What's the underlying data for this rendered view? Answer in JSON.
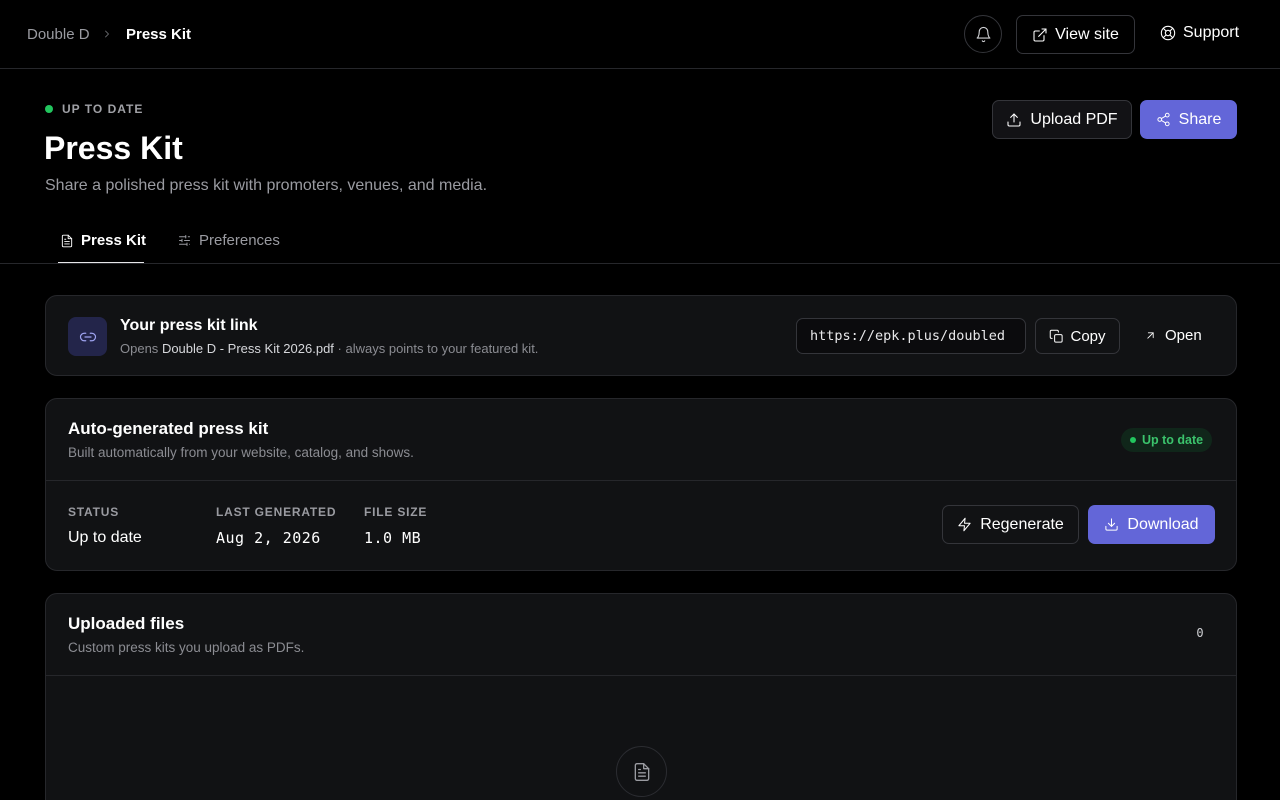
{
  "breadcrumb": {
    "parent": "Double D",
    "current": "Press Kit"
  },
  "topbar": {
    "view_site_label": "View site",
    "support_label": "Support"
  },
  "header": {
    "status": "UP TO DATE",
    "title": "Press Kit",
    "subtitle": "Share a polished press kit with promoters, venues, and media.",
    "upload_label": "Upload PDF",
    "share_label": "Share"
  },
  "tabs": [
    {
      "label": "Press Kit",
      "active": true
    },
    {
      "label": "Preferences",
      "active": false
    }
  ],
  "link_card": {
    "title": "Your press kit link",
    "desc_prefix": "Opens",
    "file_name": "Double D - Press Kit 2026.pdf",
    "desc_suffix": "· always points to your featured kit.",
    "url": "https://epk.plus/doubled",
    "copy_label": "Copy",
    "open_label": "Open"
  },
  "auto_card": {
    "title": "Auto-generated press kit",
    "desc": "Built automatically from your website, catalog, and shows.",
    "badge": "Up to date",
    "status_label": "STATUS",
    "status_value": "Up to date",
    "last_generated_label": "LAST GENERATED",
    "last_generated_value": "Aug 2, 2026",
    "file_size_label": "FILE SIZE",
    "file_size_value": "1.0 MB",
    "regenerate_label": "Regenerate",
    "download_label": "Download"
  },
  "files_card": {
    "title": "Uploaded files",
    "desc": "Custom press kits you upload as PDFs.",
    "count": "0"
  },
  "colors": {
    "accent": "#6366d8",
    "success": "#22c55e",
    "background": "#000000",
    "card": "#111214"
  },
  "icons": {
    "bell": "bell-icon",
    "view_site": "external-link-icon",
    "support": "lifebuoy-icon",
    "upload": "upload-icon",
    "share": "share-icon",
    "link": "link-icon",
    "copy": "copy-icon",
    "open": "arrow-up-right-icon",
    "regenerate": "zap-icon",
    "download": "download-icon",
    "empty": "document-icon"
  }
}
